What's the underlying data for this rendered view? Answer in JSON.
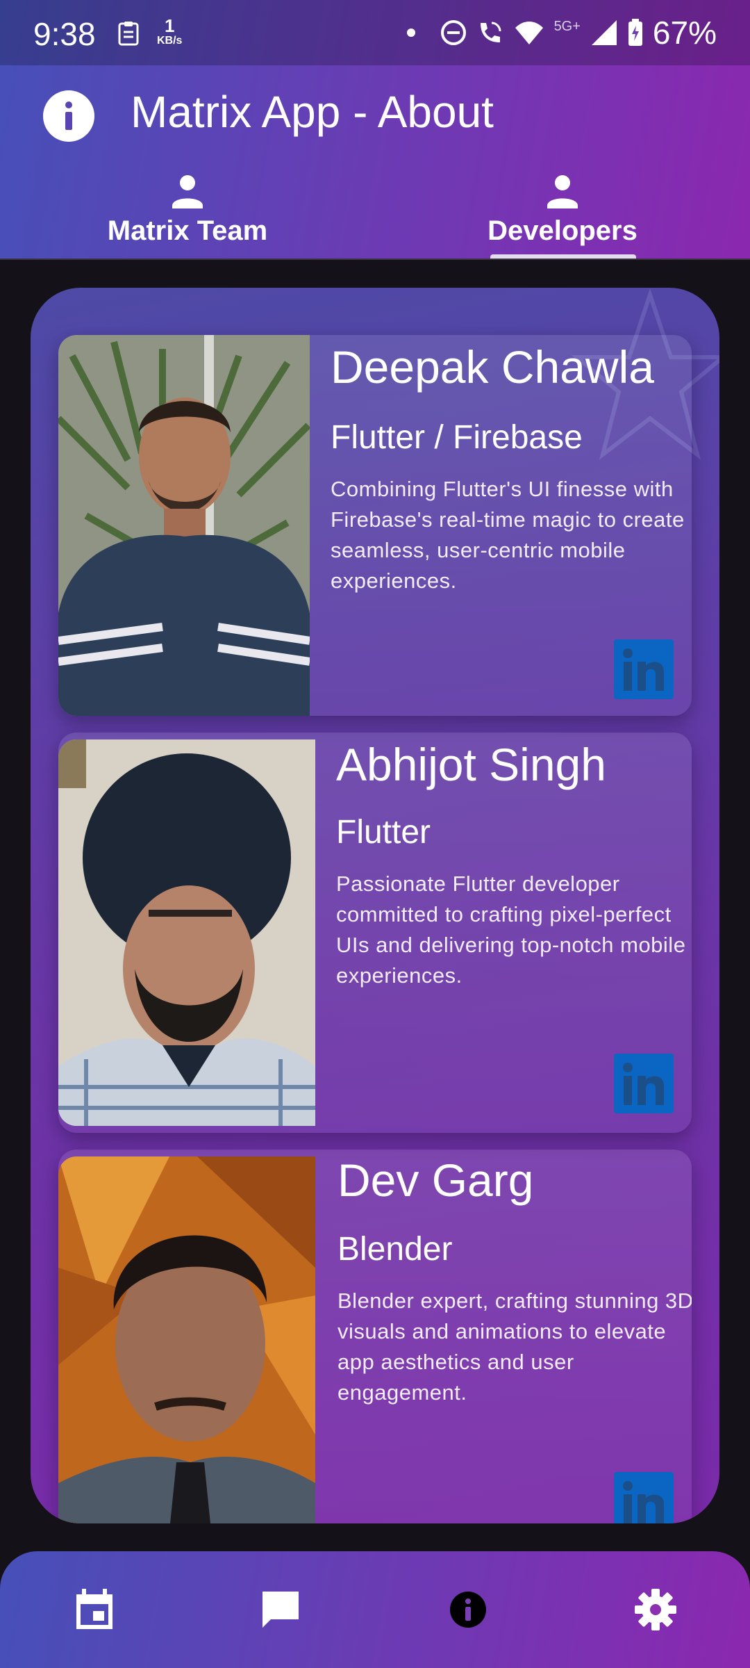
{
  "status": {
    "time": "9:38",
    "net_speed_value": "1",
    "net_speed_unit": "KB/s",
    "signal_label": "5G+",
    "battery": "67%"
  },
  "header": {
    "title": "Matrix App - About",
    "info_icon": "info-icon"
  },
  "tabs": [
    {
      "label": "Matrix Team",
      "icon": "person-icon"
    },
    {
      "label": "Developers",
      "icon": "person-icon",
      "selected": true
    }
  ],
  "developers": [
    {
      "name": "Deepak Chawla",
      "role": "Flutter / Firebase",
      "description": "Combining Flutter's UI finesse with Firebase's real-time magic to create seamless, user-centric mobile experiences.",
      "link_icon": "linkedin-icon"
    },
    {
      "name": "Abhijot Singh",
      "role": "Flutter",
      "description": "Passionate Flutter developer committed to crafting pixel-perfect UIs and delivering top-notch mobile experiences.",
      "link_icon": "linkedin-icon"
    },
    {
      "name": "Dev Garg",
      "role": "Blender",
      "description": "Blender expert, crafting stunning 3D visuals and animations to elevate app aesthetics and user engagement.",
      "link_icon": "linkedin-icon"
    }
  ],
  "bottom_nav": [
    {
      "icon": "calendar-icon"
    },
    {
      "icon": "chat-icon"
    },
    {
      "icon": "info-icon",
      "selected": true
    },
    {
      "icon": "settings-icon"
    }
  ],
  "colors": {
    "gradient_start": "#4650b8",
    "gradient_end": "#8b28b0",
    "linkedin": "#0a66c2",
    "background": "#141218"
  }
}
